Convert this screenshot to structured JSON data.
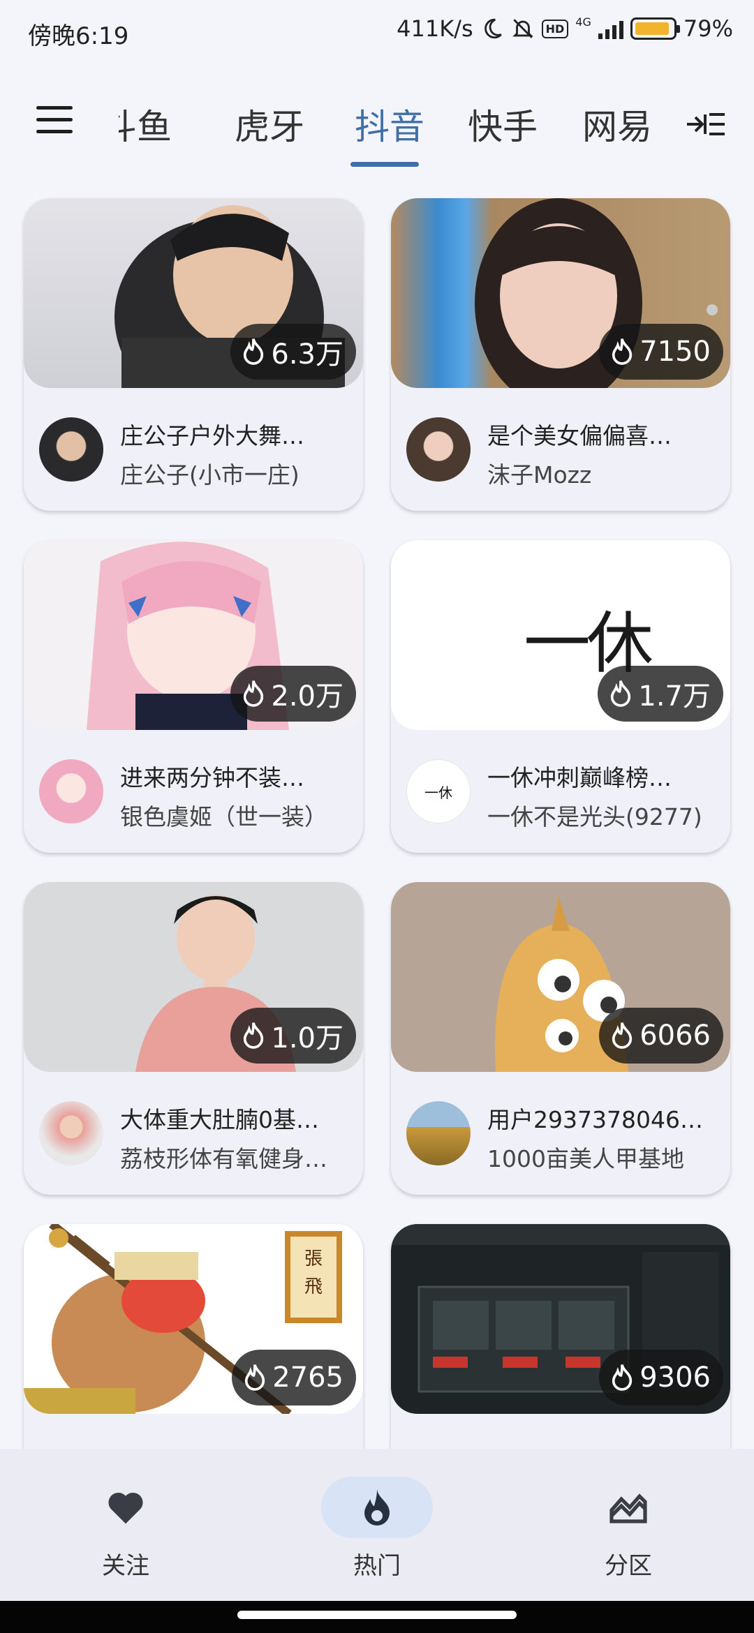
{
  "status_bar": {
    "time": "傍晚6:19",
    "network_speed": "411K/s",
    "hd_badge": "HD",
    "network_type": "4G",
    "battery": "79%"
  },
  "nav": {
    "tabs": [
      {
        "label": "斗鱼"
      },
      {
        "label": "虎牙"
      },
      {
        "label": "抖音"
      },
      {
        "label": "快手"
      },
      {
        "label": "网易"
      }
    ],
    "active_tab": "抖音"
  },
  "cards": [
    {
      "heat": "6.3万",
      "title": "庄公子户外大舞…",
      "streamer": "庄公子(小市一庄)"
    },
    {
      "heat": "7150",
      "title": "是个美女偏偏喜…",
      "streamer": "沫子Mozz"
    },
    {
      "heat": "2.0万",
      "title": "进来两分钟不装…",
      "streamer": "银色虞姬（世一装）"
    },
    {
      "heat": "1.7万",
      "title": "一休冲刺巅峰榜…",
      "streamer": "一休不是光头(9277)",
      "thumb_text": "一休",
      "avatar_text": "一休"
    },
    {
      "heat": "1.0万",
      "title": "大体重大肚腩0基…",
      "streamer": "荔枝形体有氧健身…"
    },
    {
      "heat": "6066",
      "title": "用户2937378046…",
      "streamer": "1000亩美人甲基地"
    },
    {
      "heat": "2765",
      "thumb_text": "張飛"
    },
    {
      "heat": "9306"
    }
  ],
  "bottom_nav": {
    "follow": "关注",
    "hot": "热门",
    "category": "分区"
  },
  "colors": {
    "accent": "#3f6fa5",
    "background": "#f4f5fb",
    "card": "#f0f1f8",
    "active_pill": "#d8e3f5"
  }
}
